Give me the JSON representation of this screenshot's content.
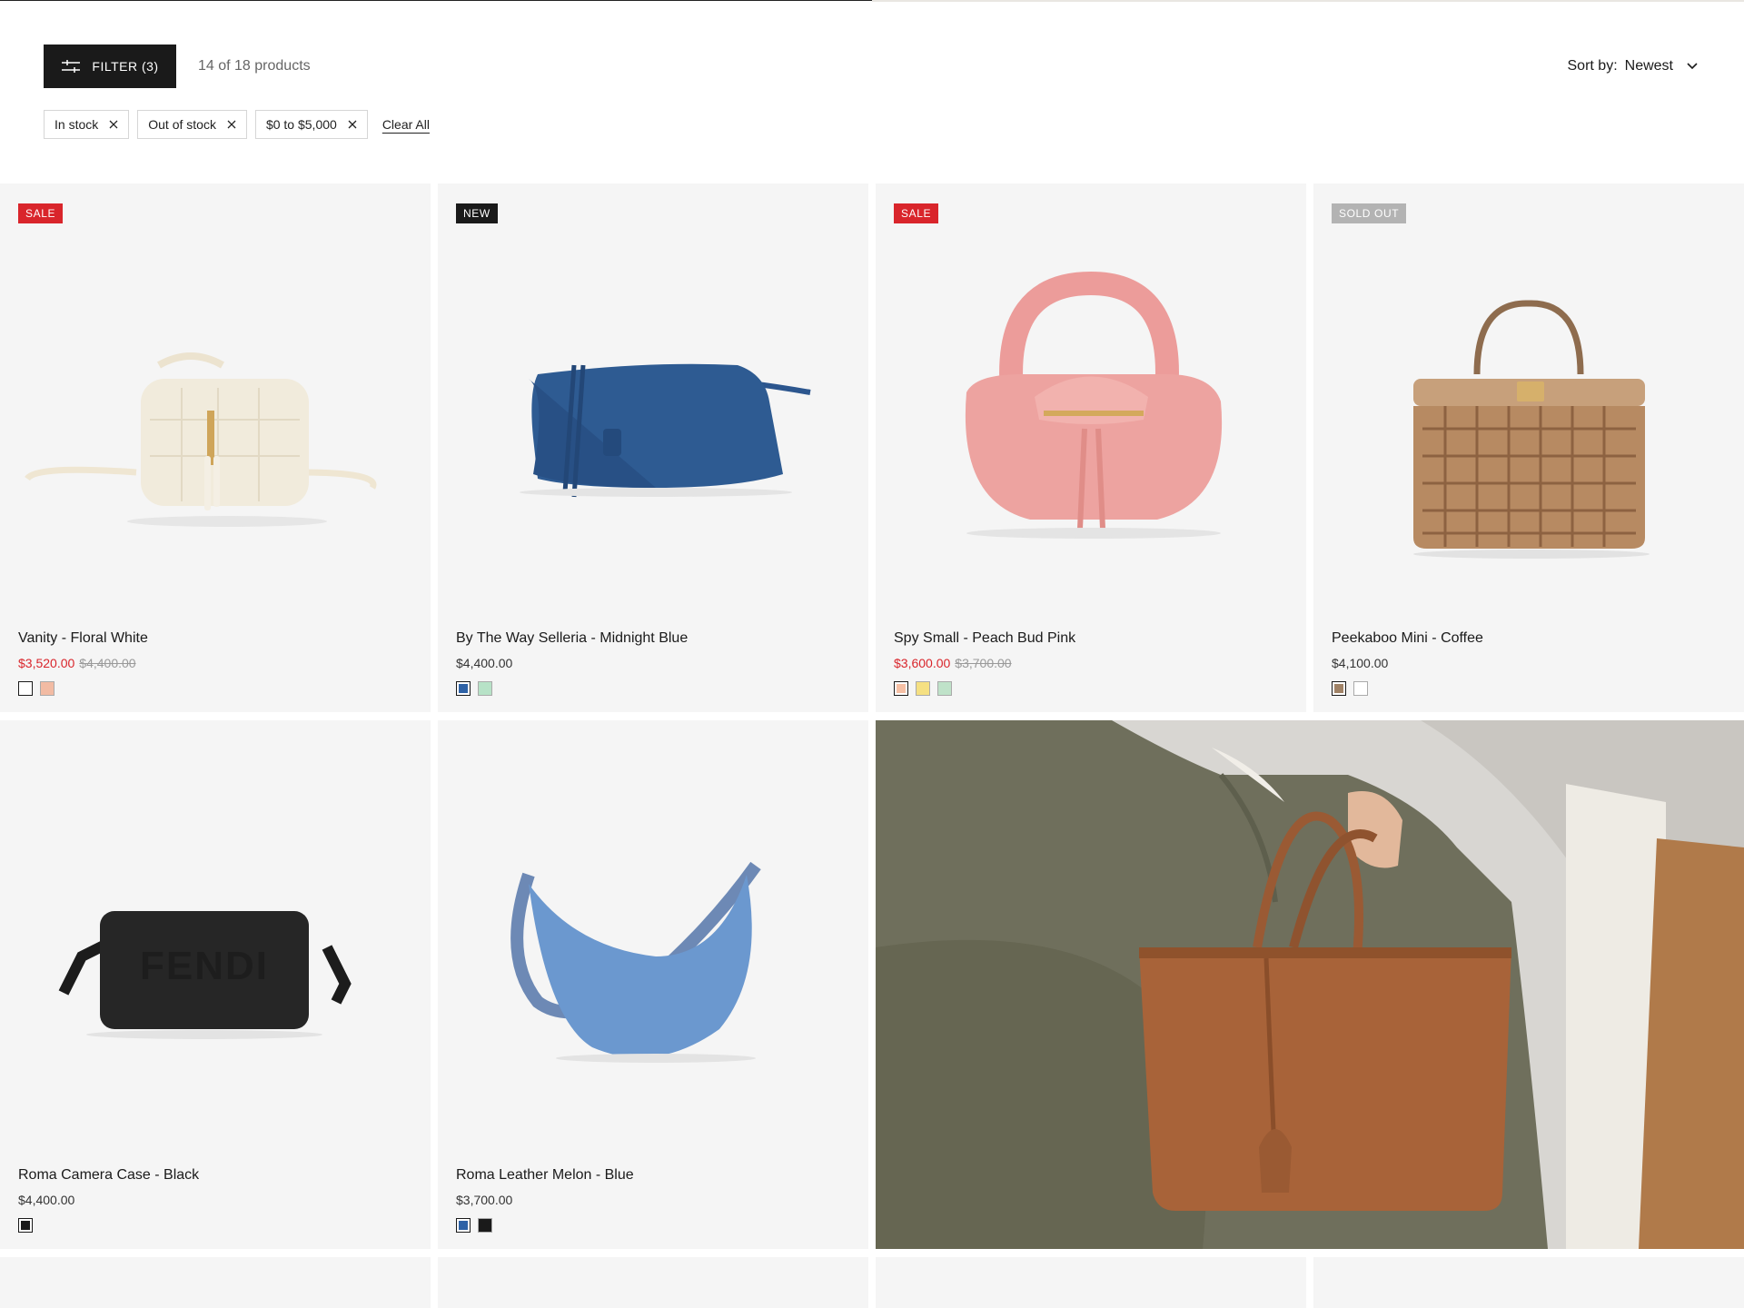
{
  "toolbar": {
    "filter_label": "FILTER (3)",
    "results_count": "14 of 18 products",
    "sort_label": "Sort by:",
    "sort_value": "Newest"
  },
  "active_filters": {
    "chips": [
      "In stock",
      "Out of stock",
      "$0 to $5,000"
    ],
    "clear_label": "Clear All"
  },
  "products": [
    {
      "badge": "SALE",
      "name": "Vanity - Floral White",
      "price": "$3,520.00",
      "compare_price": "$4,400.00",
      "swatches": [
        "#ffffff",
        "#f2bba3"
      ]
    },
    {
      "badge": "NEW",
      "name": "By The Way Selleria - Midnight Blue",
      "price": "$4,400.00",
      "compare_price": "",
      "swatches": [
        "#2e62a6",
        "#b7e2c7"
      ]
    },
    {
      "badge": "SALE",
      "name": "Spy Small - Peach Bud Pink",
      "price": "$3,600.00",
      "compare_price": "$3,700.00",
      "swatches": [
        "#f6c0a5",
        "#f5e082",
        "#bfe2c9"
      ]
    },
    {
      "badge": "SOLD OUT",
      "name": "Peekaboo Mini - Coffee",
      "price": "$4,100.00",
      "compare_price": "",
      "swatches": [
        "#a08266",
        "#ffffff"
      ]
    },
    {
      "badge": "",
      "name": "Roma Camera Case - Black",
      "price": "$4,400.00",
      "compare_price": "",
      "swatches": [
        "#1a1a1a"
      ]
    },
    {
      "badge": "",
      "name": "Roma Leather Melon - Blue",
      "price": "$3,700.00",
      "compare_price": "",
      "swatches": [
        "#2e62a6",
        "#1a1a1a"
      ]
    }
  ],
  "colors": {
    "sale_red": "#d9252b",
    "dark": "#1a1a1a",
    "card_bg": "#f5f5f5",
    "sold_out_grey": "#b3b3b3"
  },
  "icons": [
    "sliders-icon",
    "chevron-down-icon",
    "close-icon"
  ]
}
